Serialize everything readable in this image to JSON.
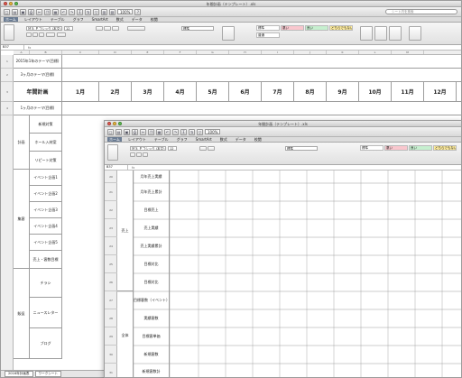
{
  "back_window": {
    "title": "年間計画（テンプレート）.xls",
    "search_placeholder": "シート内を検索",
    "zoom": "100%",
    "tabs": [
      "ホーム",
      "レイアウト",
      "テーブル",
      "グラフ",
      "SmartArt",
      "数式",
      "データ",
      "校閲"
    ],
    "font_name": "ＭＳ Ｐゴシック (本文)",
    "font_size": "12",
    "num_format": "標準",
    "styles": [
      {
        "label": "標準",
        "color": "#ffffff"
      },
      {
        "label": "悪い",
        "color": "#f9c7ce"
      },
      {
        "label": "良い",
        "color": "#c6efcf"
      },
      {
        "label": "どちらでもない",
        "color": "#fdeb9c"
      },
      {
        "label": "普通",
        "color": "#ffffff"
      }
    ],
    "name_box": "B37",
    "columns": [
      "",
      "A",
      "B",
      "C",
      "D",
      "E",
      "F",
      "G",
      "H",
      "I",
      "J",
      "K",
      "L",
      "M"
    ],
    "rows": {
      "r1": "2015年1年のテーマ(目標)",
      "r2": "3ヶ月のテーマ(目標)",
      "r3_title": "年間計画",
      "months": [
        "1月",
        "2月",
        "3月",
        "4月",
        "5月",
        "6月",
        "7月",
        "8月",
        "9月",
        "10月",
        "11月",
        "12月"
      ],
      "r4": "1ヶ月のテーマ(目標)",
      "group_plan": "計画",
      "plan_items": [
        "新規対策",
        "ホール入材案",
        "リピート対策"
      ],
      "group_collect": "集客",
      "collect_items": [
        "イベント企画1",
        "イベント企画2",
        "イベント企画3",
        "イベント企画4",
        "イベント企画5",
        "売上・客数目標"
      ],
      "group_sales": "販促",
      "sales_items": [
        "チラシ",
        "ニュースレター",
        "ブログ"
      ],
      "row_numbers": [
        "1",
        "2",
        "3",
        "4",
        "5",
        "6",
        "7",
        "8",
        "9",
        "10",
        "11",
        "12",
        "13",
        "14",
        "15",
        "16",
        "17",
        "18",
        "19",
        "20",
        "21"
      ]
    },
    "sheet_tabs": [
      "2016年計画表",
      "ワークシート"
    ]
  },
  "front_window": {
    "title": "年間計画（テンプレート）.xls",
    "zoom": "100%",
    "tabs": [
      "ホーム",
      "レイアウト",
      "テーブル",
      "グラフ",
      "SmartArt",
      "数式",
      "データ",
      "校閲"
    ],
    "font_name": "ＭＳ Ｐゴシック (本文)",
    "font_size": "12",
    "num_format": "標準",
    "styles": [
      {
        "label": "標準",
        "color": "#ffffff"
      },
      {
        "label": "悪い",
        "color": "#f9c7ce"
      },
      {
        "label": "良い",
        "color": "#c6efcf"
      },
      {
        "label": "どちらでもない",
        "color": "#fdeb9c"
      }
    ],
    "name_box": "B37",
    "row_numbers": [
      "20",
      "21",
      "22",
      "23",
      "24",
      "25",
      "26",
      "27",
      "28",
      "29",
      "30",
      "31",
      "32",
      "33",
      "34",
      "35",
      "36"
    ],
    "group_sales": "売上",
    "sales_items": [
      "月年売上実績",
      "月年売上累計",
      "目標売上",
      "売上実績",
      "売上実績累計",
      "目標対比",
      "目標対比"
    ],
    "group_all": "全体",
    "all_items": [
      "目標客数（イベント）",
      "実績客数",
      "目標客単価",
      "新規客数",
      "新規客数計",
      "常連客数"
    ]
  }
}
